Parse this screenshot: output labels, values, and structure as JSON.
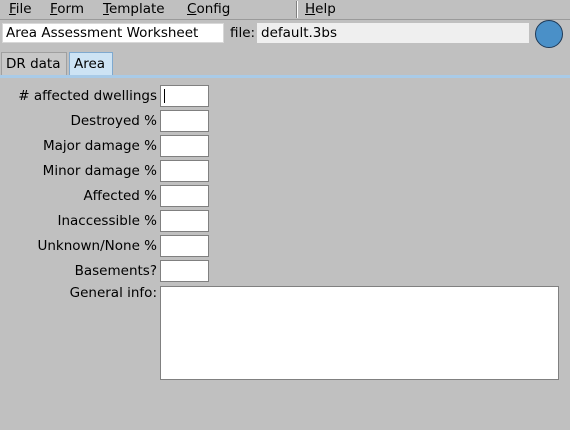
{
  "menu": {
    "file": {
      "mnemonic": "F",
      "rest": "ile"
    },
    "form": {
      "mnemonic": "F",
      "rest": "orm"
    },
    "template": {
      "mnemonic": "T",
      "rest": "emplate"
    },
    "config": {
      "mnemonic": "C",
      "rest": "onfig"
    },
    "help": {
      "mnemonic": "H",
      "rest": "elp"
    }
  },
  "header": {
    "title": "Area Assessment Worksheet",
    "file_label": "file:",
    "file_value": "default.3bs",
    "status_color": "#4a90c8"
  },
  "tabs": [
    {
      "label": "DR data",
      "active": false
    },
    {
      "label": "Area",
      "active": true
    }
  ],
  "form": {
    "fields": [
      {
        "label": "# affected dwellings",
        "value": ""
      },
      {
        "label": "Destroyed %",
        "value": ""
      },
      {
        "label": "Major damage %",
        "value": ""
      },
      {
        "label": "Minor damage %",
        "value": ""
      },
      {
        "label": "Affected %",
        "value": ""
      },
      {
        "label": "Inaccessible %",
        "value": ""
      },
      {
        "label": "Unknown/None %",
        "value": ""
      },
      {
        "label": "Basements?",
        "value": ""
      }
    ],
    "general_info_label": "General info:",
    "general_info_value": ""
  }
}
